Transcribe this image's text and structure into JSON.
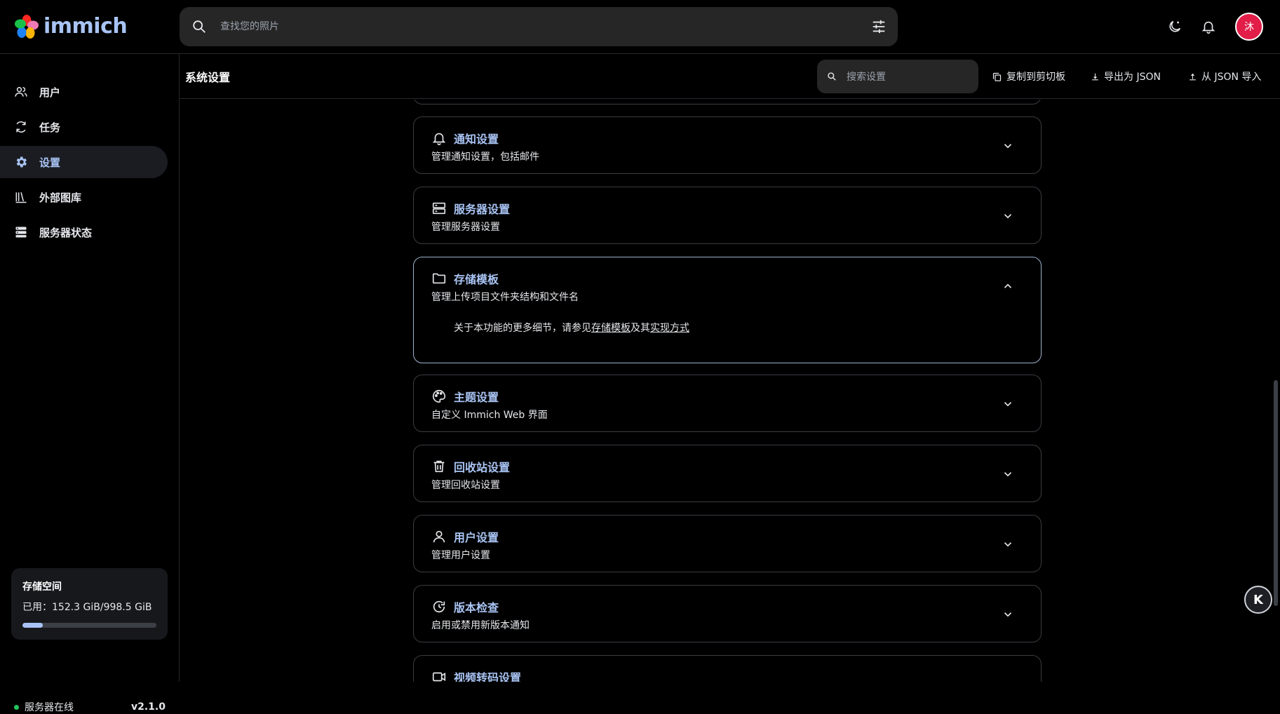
{
  "app": {
    "name": "immich"
  },
  "search": {
    "placeholder": "查找您的照片"
  },
  "header": {
    "avatar_initial": "沐"
  },
  "sidebar": {
    "items": [
      {
        "label": "用户",
        "icon": "users-icon"
      },
      {
        "label": "任务",
        "icon": "sync-icon"
      },
      {
        "label": "设置",
        "icon": "gear-icon",
        "active": true
      },
      {
        "label": "外部图库",
        "icon": "library-icon"
      },
      {
        "label": "服务器状态",
        "icon": "server-icon"
      }
    ],
    "storage": {
      "title": "存储空间",
      "usage": "已用：152.3 GiB/998.5 GiB",
      "used_fraction": 0.153
    },
    "server_status": "服务器在线",
    "version": "v2.1.0"
  },
  "page": {
    "title": "系统设置",
    "search_placeholder": "搜索设置",
    "copy_label": "复制到剪切板",
    "export_label": "导出为 JSON",
    "import_label": "从 JSON 导入"
  },
  "settings": [
    {
      "title": "通知设置",
      "description": "管理通知设置，包括邮件",
      "icon": "bell-icon"
    },
    {
      "title": "服务器设置",
      "description": "管理服务器设置",
      "icon": "server-icon"
    },
    {
      "title": "存储模板",
      "description": "管理上传项目文件夹结构和文件名",
      "icon": "folder-icon",
      "expanded": true,
      "body": {
        "prefix": "关于本功能的更多细节，请参见",
        "link1": "存储模板",
        "middle": "及其",
        "link2": "实现方式"
      }
    },
    {
      "title": "主题设置",
      "description": "自定义 Immich Web 界面",
      "icon": "palette-icon"
    },
    {
      "title": "回收站设置",
      "description": "管理回收站设置",
      "icon": "trash-icon"
    },
    {
      "title": "用户设置",
      "description": "管理用户设置",
      "icon": "user-icon"
    },
    {
      "title": "版本检查",
      "description": "启用或禁用新版本通知",
      "icon": "update-icon"
    },
    {
      "title": "视频转码设置",
      "description": "",
      "icon": "video-icon"
    }
  ],
  "floating": {
    "k_label": "K"
  },
  "colors": {
    "accent": "#a9c4f4",
    "background": "#000000",
    "card_border": "#3a3c42",
    "online": "#22c55e",
    "avatar": "#e11d48"
  }
}
